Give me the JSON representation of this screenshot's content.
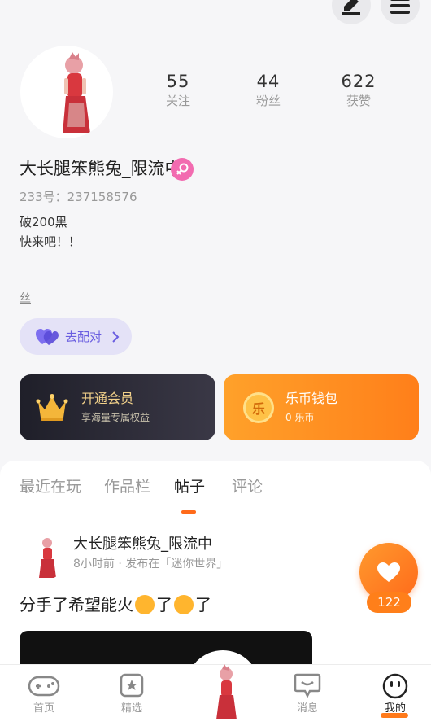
{
  "profile": {
    "nickname": "大长腿笨熊兔_限流中",
    "uid": "233号：237158576",
    "bio_line1": "破200黑",
    "bio_line2": "快来吧！！",
    "extra_tag": "丝",
    "gender": "female"
  },
  "stats": [
    {
      "value": "55",
      "label": "关注"
    },
    {
      "value": "44",
      "label": "粉丝"
    },
    {
      "value": "622",
      "label": "获赞"
    }
  ],
  "pair_button": {
    "label": "去配对"
  },
  "vip_card": {
    "title": "开通会员",
    "subtitle": "享海量专属权益"
  },
  "wallet_card": {
    "title": "乐币钱包",
    "subtitle": "0 乐币",
    "coin_glyph": "乐"
  },
  "tabs": [
    {
      "label": "最近在玩"
    },
    {
      "label": "作品栏"
    },
    {
      "label": "帖子"
    },
    {
      "label": "评论"
    }
  ],
  "active_tab": "帖子",
  "post": {
    "author": "大长腿笨熊兔_限流中",
    "meta": "8小时前 · 发布在「迷你世界」",
    "text_part1": "分手了希望能火",
    "text_part2": "了",
    "text_part3": "了",
    "like_count": "122"
  },
  "bottom_nav": [
    {
      "label": "首页",
      "icon": "gamepad-icon"
    },
    {
      "label": "精选",
      "icon": "star-bookmark-icon"
    },
    {
      "label": "",
      "icon": "avatar-center-icon"
    },
    {
      "label": "消息",
      "icon": "chat-bubble-icon"
    },
    {
      "label": "我的",
      "icon": "face-icon"
    }
  ],
  "colors": {
    "accent": "#ff7a1a",
    "pair_purple": "#6a5ee0",
    "gender_pink": "#f26bb0",
    "vip_gold": "#f2d18a"
  }
}
